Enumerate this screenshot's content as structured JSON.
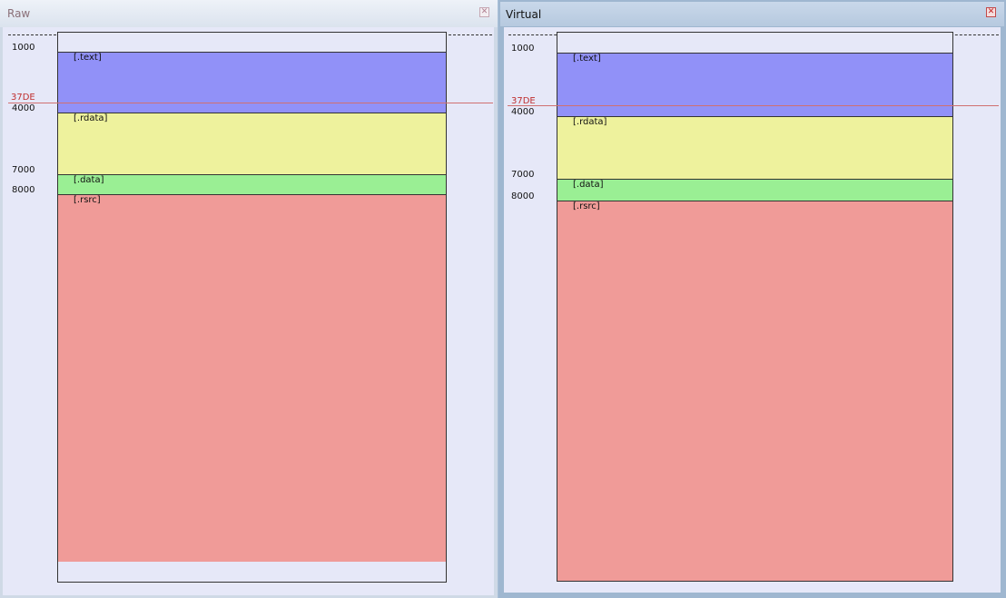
{
  "colors": {
    "text": "#9191f8",
    "rdata": "#eef29d",
    "data": "#9aef94",
    "rsrc": "#f09b98",
    "marker": "#c03030"
  },
  "raw": {
    "title": "Raw",
    "close_icon": "close-icon",
    "marker_label": "37DE",
    "addresses": [
      "1000",
      "4000",
      "7000",
      "8000"
    ],
    "sections": [
      ".text",
      ".rdata",
      ".data",
      ".rsrc"
    ]
  },
  "virtual": {
    "title": "Virtual",
    "close_icon": "close-icon",
    "marker_label": "37DE",
    "addresses": [
      "1000",
      "4000",
      "7000",
      "8000"
    ],
    "sections": [
      ".text",
      ".rdata",
      ".data",
      ".rsrc"
    ]
  }
}
